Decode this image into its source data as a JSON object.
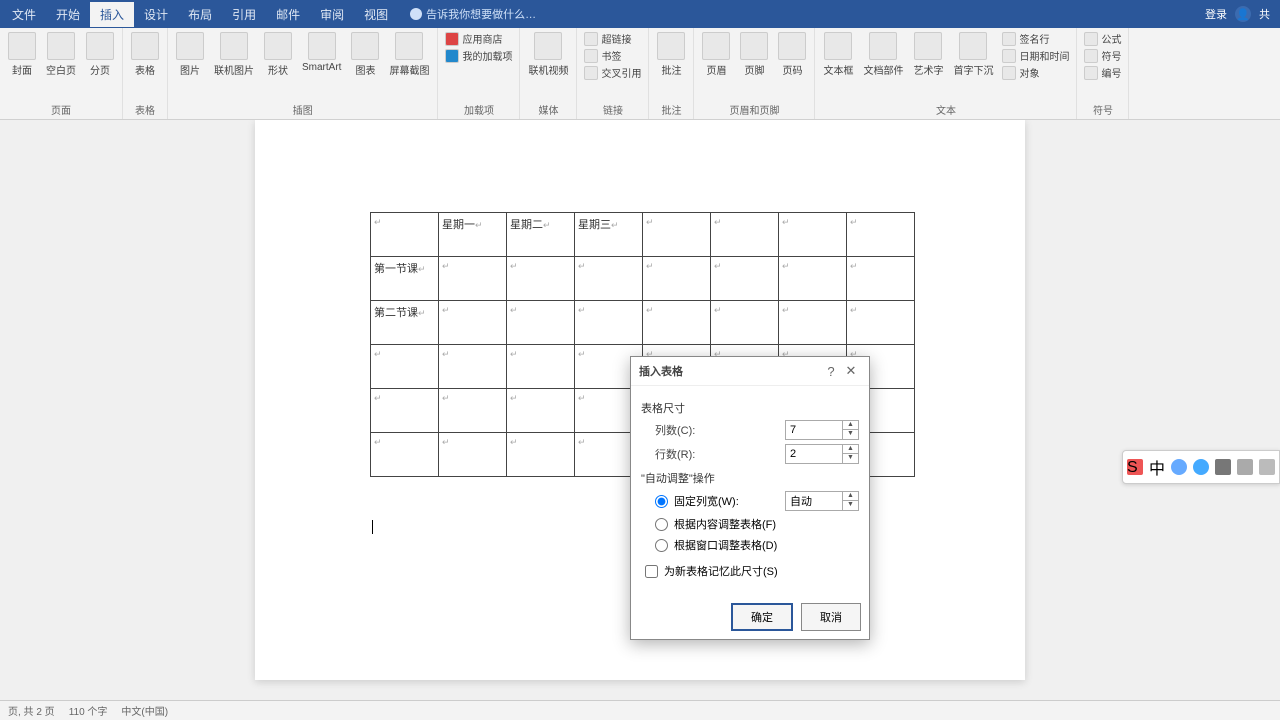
{
  "tabs": {
    "file": "文件",
    "home": "开始",
    "insert": "插入",
    "design": "设计",
    "layout": "布局",
    "references": "引用",
    "mailings": "邮件",
    "review": "审阅",
    "view": "视图",
    "tellme": "告诉我你想要做什么…"
  },
  "titlebar": {
    "signin": "登录",
    "share": "共"
  },
  "ribbon": {
    "pages": {
      "cover": "封面",
      "blank": "空白页",
      "break": "分页",
      "label": "页面"
    },
    "tables": {
      "table": "表格",
      "label": "表格"
    },
    "illus": {
      "pic": "图片",
      "online": "联机图片",
      "shapes": "形状",
      "smartart": "SmartArt",
      "chart": "图表",
      "screenshot": "屏幕截图",
      "label": "插图"
    },
    "addins": {
      "store": "应用商店",
      "myaddins": "我的加载项",
      "label": "加载项"
    },
    "media": {
      "video": "联机视频",
      "label": "媒体"
    },
    "links": {
      "hyperlink": "超链接",
      "bookmark": "书签",
      "crossref": "交叉引用",
      "label": "链接"
    },
    "comments": {
      "comment": "批注",
      "label": "批注"
    },
    "headerfooter": {
      "header": "页眉",
      "footer": "页脚",
      "pagenum": "页码",
      "label": "页眉和页脚"
    },
    "text": {
      "textbox": "文本框",
      "quickparts": "文档部件",
      "wordart": "艺术字",
      "dropcap": "首字下沉",
      "label": "文本"
    },
    "symbols": {
      "equation": "公式",
      "symbol": "符号",
      "number": "编号",
      "label": "符号"
    },
    "extra": {
      "sig": "签名行",
      "date": "日期和时间",
      "obj": "对象"
    }
  },
  "table": {
    "r1": {
      "c2": "星期一",
      "c3": "星期二",
      "c4": "星期三"
    },
    "r2": {
      "c1": "第一节课"
    },
    "r3": {
      "c1": "第二节课"
    }
  },
  "dialog": {
    "title": "插入表格",
    "size": "表格尺寸",
    "cols": "列数(C):",
    "rows": "行数(R):",
    "cols_val": "7",
    "rows_val": "2",
    "autofit": "\"自动调整\"操作",
    "fixed": "固定列宽(W):",
    "fixed_val": "自动",
    "fitcontent": "根据内容调整表格(F)",
    "fitwindow": "根据窗口调整表格(D)",
    "remember": "为新表格记忆此尺寸(S)",
    "ok": "确定",
    "cancel": "取消"
  },
  "status": {
    "page": "页, 共 2 页",
    "words": "110 个字",
    "lang": "中文(中国)"
  }
}
